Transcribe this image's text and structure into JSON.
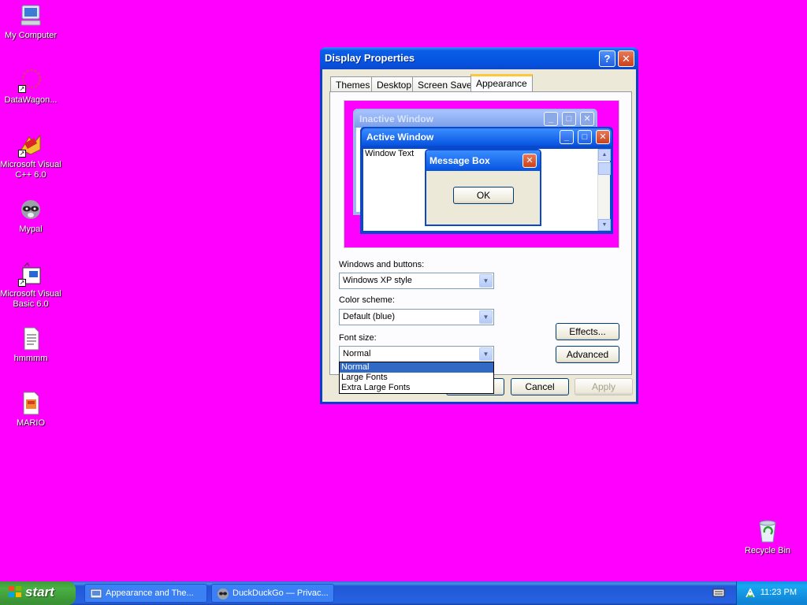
{
  "desktop": {
    "icons": [
      {
        "label": "My Computer",
        "icon": "computer-icon"
      },
      {
        "label": "DataWagon...",
        "icon": "shortcut-icon"
      },
      {
        "label": "Microsoft Visual C++ 6.0",
        "icon": "visual-cpp-icon"
      },
      {
        "label": "Mypal",
        "icon": "raccoon-icon"
      },
      {
        "label": "Microsoft Visual Basic 6.0",
        "icon": "visual-basic-icon"
      },
      {
        "label": "hmmmm",
        "icon": "text-file-icon"
      },
      {
        "label": "MARIO",
        "icon": "image-file-icon"
      }
    ],
    "recycle_bin": {
      "label": "Recycle Bin",
      "icon": "recycle-bin-icon"
    }
  },
  "dialog": {
    "title": "Display Properties",
    "help_glyph": "?",
    "close_glyph": "✕",
    "tabs": [
      "Themes",
      "Desktop",
      "Screen Saver",
      "Appearance"
    ],
    "active_tab": "Appearance",
    "preview": {
      "inactive_title": "Inactive Window",
      "active_title": "Active Window",
      "window_text": "Window Text",
      "message_box_title": "Message Box",
      "ok_label": "OK"
    },
    "windows_and_buttons": {
      "label": "Windows and buttons:",
      "value": "Windows XP style"
    },
    "color_scheme": {
      "label": "Color scheme:",
      "value": "Default (blue)"
    },
    "font_size": {
      "label": "Font size:",
      "value": "Normal",
      "options": [
        "Normal",
        "Large Fonts",
        "Extra Large Fonts"
      ],
      "selected_index": 0
    },
    "effects_label": "Effects...",
    "advanced_label": "Advanced",
    "cancel_label": "Cancel",
    "apply_label": "Apply"
  },
  "taskbar": {
    "start_label": "start",
    "tasks": [
      {
        "label": "Appearance and The...",
        "icon": "control-panel-icon"
      },
      {
        "label": "DuckDuckGo — Privac...",
        "icon": "raccoon-icon"
      }
    ],
    "clock": "11:23 PM"
  },
  "colors": {
    "desktop_background": "#ff00ff",
    "title_blue": "#0653e0",
    "dialog_face": "#ece9d8",
    "selection": "#316ac5",
    "start_green": "#4ab143"
  }
}
